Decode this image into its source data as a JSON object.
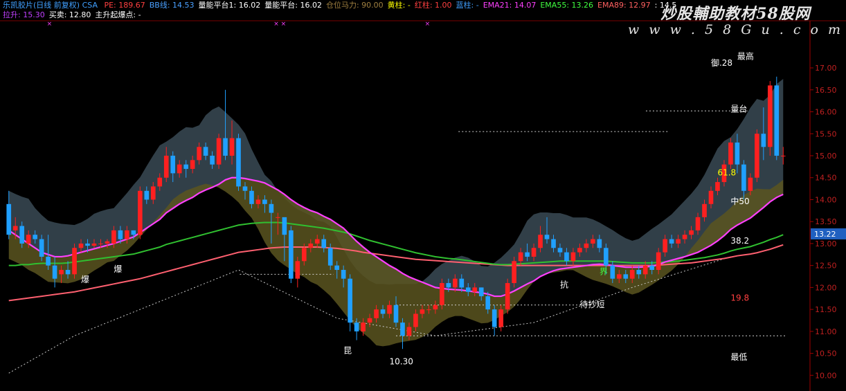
{
  "header": {
    "title": "乐凯胶片(日线 前复权) CSA",
    "items": [
      {
        "label": "PE: 189.67",
        "color": "#ff4040"
      },
      {
        "label": "BB线: 14.53",
        "color": "#4aa0ff"
      },
      {
        "label": "量能平台1: 16.02",
        "color": "#ffffff"
      },
      {
        "label": "量能平台: 16.02",
        "color": "#ffffff"
      },
      {
        "label": "仓位马力: 90.00",
        "color": "#a08040"
      },
      {
        "label": "黄柱: -",
        "color": "#ffff00"
      },
      {
        "label": "红柱: 1.00",
        "color": "#ff4040"
      },
      {
        "label": "蓝柱: -",
        "color": "#40a0ff"
      },
      {
        "label": "EMA21: 14.07",
        "color": "#ff40ff"
      },
      {
        "label": "EMA55: 13.26",
        "color": "#40ff40"
      },
      {
        "label": "EMA89: 12.97",
        "color": "#ff6060"
      },
      {
        "label": ": 14.5",
        "color": "#ffffff"
      }
    ],
    "row2": [
      {
        "label": "拉升: 15.30",
        "color": "#c040ff"
      },
      {
        "label": "买卖: 12.80",
        "color": "#ffffff"
      },
      {
        "label": "主升起爆点: -",
        "color": "#ffffff"
      }
    ]
  },
  "watermark": {
    "line1": "炒股輔助教材58股网",
    "line2": "w w w . 5 8 G u . c o m"
  },
  "price_tag": "13.22",
  "colors": {
    "up": "#ff2020",
    "down": "#20a0ff",
    "ema21": "#ff40ff",
    "ema55": "#30c030",
    "ema89": "#ff6070",
    "cloud": "#3a4a55",
    "band": "#5a5520"
  },
  "chart_data": {
    "type": "candlestick",
    "ylim": [
      9.8,
      17.6
    ],
    "yticks": [
      10.0,
      10.5,
      11.0,
      11.5,
      12.0,
      12.5,
      13.0,
      13.5,
      14.0,
      14.5,
      15.0,
      15.5,
      16.0,
      16.5,
      17.0
    ],
    "ytick_labels": [
      "10.00",
      "10.50",
      "11.00",
      "11.50",
      "12.00",
      "12.50",
      "13.00",
      "13.50",
      "14.00",
      "14.50",
      "15.00",
      "15.50",
      "16.00",
      "16.50",
      "17.00"
    ],
    "candles": [
      [
        13.9,
        13.2,
        14.2,
        13.1
      ],
      [
        13.3,
        13.4,
        13.6,
        13.1
      ],
      [
        13.4,
        13.0,
        13.5,
        12.9
      ],
      [
        13.0,
        13.2,
        13.3,
        12.9
      ],
      [
        13.2,
        13.1,
        13.3,
        13.0
      ],
      [
        13.1,
        12.7,
        13.2,
        12.6
      ],
      [
        12.7,
        12.5,
        13.2,
        12.4
      ],
      [
        12.5,
        12.2,
        12.7,
        12.0
      ],
      [
        12.3,
        12.4,
        12.5,
        12.1
      ],
      [
        12.4,
        12.3,
        12.6,
        12.2
      ],
      [
        12.3,
        12.9,
        13.0,
        12.2
      ],
      [
        12.9,
        13.0,
        13.1,
        12.8
      ],
      [
        13.0,
        12.95,
        13.1,
        12.8
      ],
      [
        12.95,
        13.0,
        13.1,
        12.9
      ],
      [
        13.0,
        13.0,
        13.1,
        12.9
      ],
      [
        13.0,
        13.05,
        13.1,
        12.9
      ],
      [
        13.0,
        13.3,
        13.4,
        12.9
      ],
      [
        13.3,
        13.1,
        13.4,
        13.0
      ],
      [
        13.1,
        13.3,
        13.4,
        13.0
      ],
      [
        13.3,
        13.2,
        13.3,
        13.1
      ],
      [
        13.2,
        14.2,
        14.3,
        13.1
      ],
      [
        14.2,
        14.0,
        14.3,
        13.9
      ],
      [
        14.0,
        14.3,
        14.4,
        13.9
      ],
      [
        14.3,
        14.5,
        14.6,
        14.2
      ],
      [
        14.5,
        15.0,
        15.2,
        14.4
      ],
      [
        15.0,
        14.6,
        15.1,
        14.4
      ],
      [
        14.6,
        14.8,
        14.9,
        14.5
      ],
      [
        14.8,
        14.7,
        14.9,
        14.5
      ],
      [
        14.7,
        14.9,
        15.0,
        14.6
      ],
      [
        14.9,
        15.2,
        15.3,
        14.8
      ],
      [
        15.2,
        15.0,
        15.3,
        14.9
      ],
      [
        15.0,
        14.8,
        15.1,
        14.7
      ],
      [
        14.8,
        15.4,
        15.5,
        14.7
      ],
      [
        15.4,
        15.0,
        16.5,
        14.9
      ],
      [
        15.0,
        15.4,
        15.8,
        14.8
      ],
      [
        15.4,
        14.3,
        15.5,
        14.2
      ],
      [
        14.3,
        14.2,
        14.4,
        14.0
      ],
      [
        14.2,
        13.9,
        14.3,
        13.8
      ],
      [
        13.9,
        14.0,
        14.1,
        13.8
      ],
      [
        14.0,
        13.9,
        14.1,
        13.7
      ],
      [
        13.9,
        13.7,
        14.0,
        13.0
      ],
      [
        13.6,
        13.6,
        13.7,
        13.2
      ],
      [
        13.6,
        13.2,
        13.5,
        12.6
      ],
      [
        13.3,
        12.2,
        13.4,
        12.1
      ],
      [
        12.2,
        12.6,
        12.7,
        12.0
      ],
      [
        12.6,
        12.9,
        13.0,
        12.5
      ],
      [
        12.9,
        13.0,
        13.1,
        12.8
      ],
      [
        13.0,
        13.1,
        13.2,
        12.9
      ],
      [
        13.1,
        12.9,
        13.2,
        12.8
      ],
      [
        12.9,
        12.5,
        13.0,
        12.4
      ],
      [
        12.5,
        12.4,
        12.6,
        12.2
      ],
      [
        12.4,
        12.2,
        12.5,
        12.0
      ],
      [
        12.2,
        11.2,
        12.3,
        11.0
      ],
      [
        11.2,
        11.0,
        11.3,
        10.8
      ],
      [
        11.0,
        11.2,
        11.3,
        10.9
      ],
      [
        11.2,
        11.3,
        11.4,
        11.1
      ],
      [
        11.3,
        11.5,
        11.6,
        11.2
      ],
      [
        11.5,
        11.4,
        11.6,
        11.3
      ],
      [
        11.4,
        11.6,
        11.7,
        11.3
      ],
      [
        11.6,
        11.2,
        11.8,
        11.1
      ],
      [
        11.2,
        10.9,
        11.3,
        10.6
      ],
      [
        10.9,
        11.1,
        11.2,
        10.8
      ],
      [
        11.1,
        11.4,
        11.5,
        11.0
      ],
      [
        11.4,
        11.5,
        11.6,
        11.3
      ],
      [
        11.5,
        11.5,
        11.6,
        11.4
      ],
      [
        11.5,
        11.6,
        11.7,
        11.4
      ],
      [
        11.6,
        12.1,
        12.2,
        11.5
      ],
      [
        12.1,
        12.0,
        12.2,
        11.9
      ],
      [
        12.0,
        12.2,
        12.3,
        11.9
      ],
      [
        12.2,
        12.0,
        12.3,
        11.9
      ],
      [
        12.0,
        11.9,
        12.1,
        11.8
      ],
      [
        11.9,
        12.0,
        12.1,
        11.8
      ],
      [
        12.0,
        11.8,
        12.0,
        11.7
      ],
      [
        11.8,
        11.5,
        11.9,
        11.4
      ],
      [
        11.5,
        11.1,
        11.6,
        10.9
      ],
      [
        11.1,
        11.5,
        11.6,
        11.0
      ],
      [
        11.5,
        12.1,
        12.2,
        11.4
      ],
      [
        12.1,
        12.6,
        12.7,
        12.0
      ],
      [
        12.6,
        12.8,
        12.9,
        12.5
      ],
      [
        12.8,
        12.7,
        13.0,
        12.6
      ],
      [
        12.7,
        12.9,
        13.0,
        12.6
      ],
      [
        12.9,
        13.2,
        13.4,
        12.8
      ],
      [
        13.2,
        13.1,
        13.6,
        13.0
      ],
      [
        13.1,
        12.9,
        13.2,
        12.8
      ],
      [
        12.9,
        12.8,
        13.0,
        12.7
      ],
      [
        12.8,
        12.6,
        12.9,
        12.5
      ],
      [
        12.6,
        12.8,
        12.9,
        12.5
      ],
      [
        12.8,
        12.9,
        13.0,
        12.7
      ],
      [
        12.9,
        13.0,
        13.1,
        12.8
      ],
      [
        13.0,
        13.1,
        13.2,
        12.9
      ],
      [
        13.1,
        12.9,
        13.2,
        12.8
      ],
      [
        12.9,
        12.5,
        13.0,
        12.3
      ],
      [
        12.5,
        12.2,
        12.6,
        12.1
      ],
      [
        12.2,
        12.3,
        12.4,
        12.1
      ],
      [
        12.3,
        12.2,
        12.4,
        12.1
      ],
      [
        12.2,
        12.4,
        12.5,
        12.1
      ],
      [
        12.4,
        12.3,
        12.5,
        12.2
      ],
      [
        12.3,
        12.5,
        12.6,
        12.2
      ],
      [
        12.5,
        12.4,
        12.6,
        12.3
      ],
      [
        12.4,
        12.8,
        12.9,
        12.3
      ],
      [
        12.8,
        13.1,
        13.2,
        12.7
      ],
      [
        13.1,
        13.0,
        13.2,
        12.9
      ],
      [
        13.0,
        13.1,
        13.2,
        12.9
      ],
      [
        13.1,
        13.2,
        13.3,
        13.0
      ],
      [
        13.2,
        13.3,
        13.4,
        13.1
      ],
      [
        13.3,
        13.6,
        13.7,
        13.2
      ],
      [
        13.6,
        13.9,
        14.0,
        13.5
      ],
      [
        13.9,
        14.2,
        14.3,
        13.8
      ],
      [
        14.2,
        14.4,
        14.5,
        14.1
      ],
      [
        14.4,
        14.8,
        14.9,
        14.3
      ],
      [
        14.8,
        15.3,
        15.4,
        14.7
      ],
      [
        15.3,
        14.8,
        15.5,
        14.6
      ],
      [
        14.8,
        14.2,
        14.9,
        14.0
      ],
      [
        14.2,
        14.5,
        14.6,
        14.1
      ],
      [
        14.5,
        15.5,
        15.6,
        14.4
      ],
      [
        15.5,
        15.2,
        16.1,
        14.9
      ],
      [
        15.2,
        16.6,
        16.7,
        15.0
      ],
      [
        16.6,
        15.0,
        16.8,
        14.9
      ],
      [
        15.0,
        15.0,
        15.2,
        14.8
      ]
    ],
    "ema21": [
      13.3,
      13.2,
      13.1,
      13.0,
      12.9,
      12.8,
      12.75,
      12.7,
      12.7,
      12.72,
      12.76,
      12.8,
      12.84,
      12.88,
      12.92,
      12.96,
      13.0,
      13.05,
      13.1,
      13.15,
      13.25,
      13.35,
      13.45,
      13.55,
      13.7,
      13.8,
      13.9,
      13.98,
      14.05,
      14.15,
      14.22,
      14.28,
      14.35,
      14.45,
      14.5,
      14.5,
      14.48,
      14.45,
      14.42,
      14.38,
      14.3,
      14.22,
      14.12,
      14.0,
      13.9,
      13.82,
      13.75,
      13.7,
      13.62,
      13.55,
      13.45,
      13.35,
      13.2,
      13.05,
      12.92,
      12.8,
      12.7,
      12.6,
      12.5,
      12.42,
      12.32,
      12.24,
      12.18,
      12.12,
      12.06,
      12.0,
      11.98,
      11.96,
      11.95,
      11.94,
      11.92,
      11.9,
      11.88,
      11.85,
      11.8,
      11.8,
      11.85,
      11.92,
      12.0,
      12.08,
      12.15,
      12.25,
      12.32,
      12.38,
      12.42,
      12.44,
      12.46,
      12.48,
      12.5,
      12.52,
      12.53,
      12.52,
      12.5,
      12.48,
      12.46,
      12.46,
      12.46,
      12.47,
      12.48,
      12.52,
      12.58,
      12.62,
      12.66,
      12.7,
      12.75,
      12.8,
      12.88,
      12.96,
      13.06,
      13.18,
      13.32,
      13.42,
      13.5,
      13.58,
      13.7,
      13.82,
      13.95,
      14.05,
      14.12
    ],
    "ema55": [
      12.5,
      12.5,
      12.52,
      12.52,
      12.54,
      12.55,
      12.55,
      12.55,
      12.55,
      12.56,
      12.58,
      12.6,
      12.62,
      12.64,
      12.66,
      12.68,
      12.7,
      12.72,
      12.74,
      12.76,
      12.8,
      12.84,
      12.88,
      12.92,
      12.98,
      13.02,
      13.06,
      13.1,
      13.14,
      13.18,
      13.22,
      13.26,
      13.3,
      13.34,
      13.38,
      13.42,
      13.44,
      13.46,
      13.47,
      13.48,
      13.48,
      13.48,
      13.47,
      13.45,
      13.43,
      13.41,
      13.39,
      13.37,
      13.35,
      13.32,
      13.29,
      13.26,
      13.22,
      13.17,
      13.12,
      13.07,
      13.03,
      12.99,
      12.95,
      12.91,
      12.87,
      12.83,
      12.79,
      12.76,
      12.73,
      12.7,
      12.68,
      12.66,
      12.65,
      12.63,
      12.61,
      12.59,
      12.57,
      12.55,
      12.53,
      12.52,
      12.52,
      12.53,
      12.54,
      12.55,
      12.56,
      12.57,
      12.58,
      12.59,
      12.6,
      12.6,
      12.6,
      12.6,
      12.6,
      12.6,
      12.6,
      12.6,
      12.59,
      12.58,
      12.57,
      12.56,
      12.56,
      12.56,
      12.56,
      12.57,
      12.58,
      12.59,
      12.6,
      12.62,
      12.64,
      12.66,
      12.68,
      12.71,
      12.74,
      12.78,
      12.83,
      12.87,
      12.9,
      12.93,
      12.98,
      13.03,
      13.09,
      13.14,
      13.2
    ],
    "ema89": [
      11.7,
      11.72,
      11.74,
      11.76,
      11.78,
      11.8,
      11.82,
      11.84,
      11.86,
      11.88,
      11.9,
      11.93,
      11.96,
      11.99,
      12.02,
      12.05,
      12.08,
      12.11,
      12.14,
      12.17,
      12.2,
      12.24,
      12.28,
      12.32,
      12.36,
      12.4,
      12.44,
      12.48,
      12.52,
      12.56,
      12.6,
      12.64,
      12.68,
      12.72,
      12.76,
      12.8,
      12.82,
      12.84,
      12.86,
      12.88,
      12.9,
      12.91,
      12.92,
      12.92,
      12.92,
      12.92,
      12.92,
      12.92,
      12.91,
      12.9,
      12.89,
      12.87,
      12.85,
      12.83,
      12.8,
      12.78,
      12.76,
      12.74,
      12.72,
      12.7,
      12.68,
      12.66,
      12.64,
      12.63,
      12.62,
      12.61,
      12.6,
      12.59,
      12.58,
      12.57,
      12.56,
      12.55,
      12.54,
      12.53,
      12.52,
      12.51,
      12.5,
      12.5,
      12.5,
      12.5,
      12.5,
      12.5,
      12.5,
      12.5,
      12.5,
      12.5,
      12.5,
      12.5,
      12.5,
      12.5,
      12.5,
      12.5,
      12.5,
      12.5,
      12.5,
      12.5,
      12.5,
      12.5,
      12.5,
      12.51,
      12.52,
      12.53,
      12.54,
      12.55,
      12.56,
      12.58,
      12.6,
      12.62,
      12.64,
      12.66,
      12.69,
      12.72,
      12.74,
      12.76,
      12.79,
      12.83,
      12.87,
      12.92,
      12.97
    ],
    "labels": [
      {
        "text": "爆",
        "i": 11,
        "y": 12.12,
        "color": "#ffffff"
      },
      {
        "text": "爆",
        "i": 16,
        "y": 12.35,
        "color": "#ffffff"
      },
      {
        "text": "昆",
        "i": 51,
        "y": 10.5,
        "color": "#ffffff"
      },
      {
        "text": "10.30",
        "i": 58,
        "y": 10.25,
        "color": "#ffffff"
      },
      {
        "text": "抗",
        "i": 84,
        "y": 12.0,
        "color": "#ffffff"
      },
      {
        "text": "待抄短",
        "i": 87,
        "y": 11.55,
        "color": "#ffffff"
      },
      {
        "text": "界",
        "i": 90,
        "y": 12.3,
        "color": "#40ff40"
      },
      {
        "text": "最高",
        "i": 111,
        "y": 17.2,
        "color": "#ffffff"
      },
      {
        "text": "御.28",
        "i": 107,
        "y": 17.05,
        "color": "#ffffff"
      },
      {
        "text": "量台",
        "i": 110,
        "y": 16.0,
        "color": "#ffffff"
      },
      {
        "text": "61.8",
        "i": 108,
        "y": 14.55,
        "color": "#ffff00"
      },
      {
        "text": "中50",
        "i": 110,
        "y": 13.9,
        "color": "#ffffff"
      },
      {
        "text": "38.2",
        "i": 110,
        "y": 13.0,
        "color": "#ffffff"
      },
      {
        "text": "19.8",
        "i": 110,
        "y": 11.7,
        "color": "#ff4040"
      },
      {
        "text": "最低",
        "i": 110,
        "y": 10.35,
        "color": "#ffffff"
      }
    ]
  }
}
